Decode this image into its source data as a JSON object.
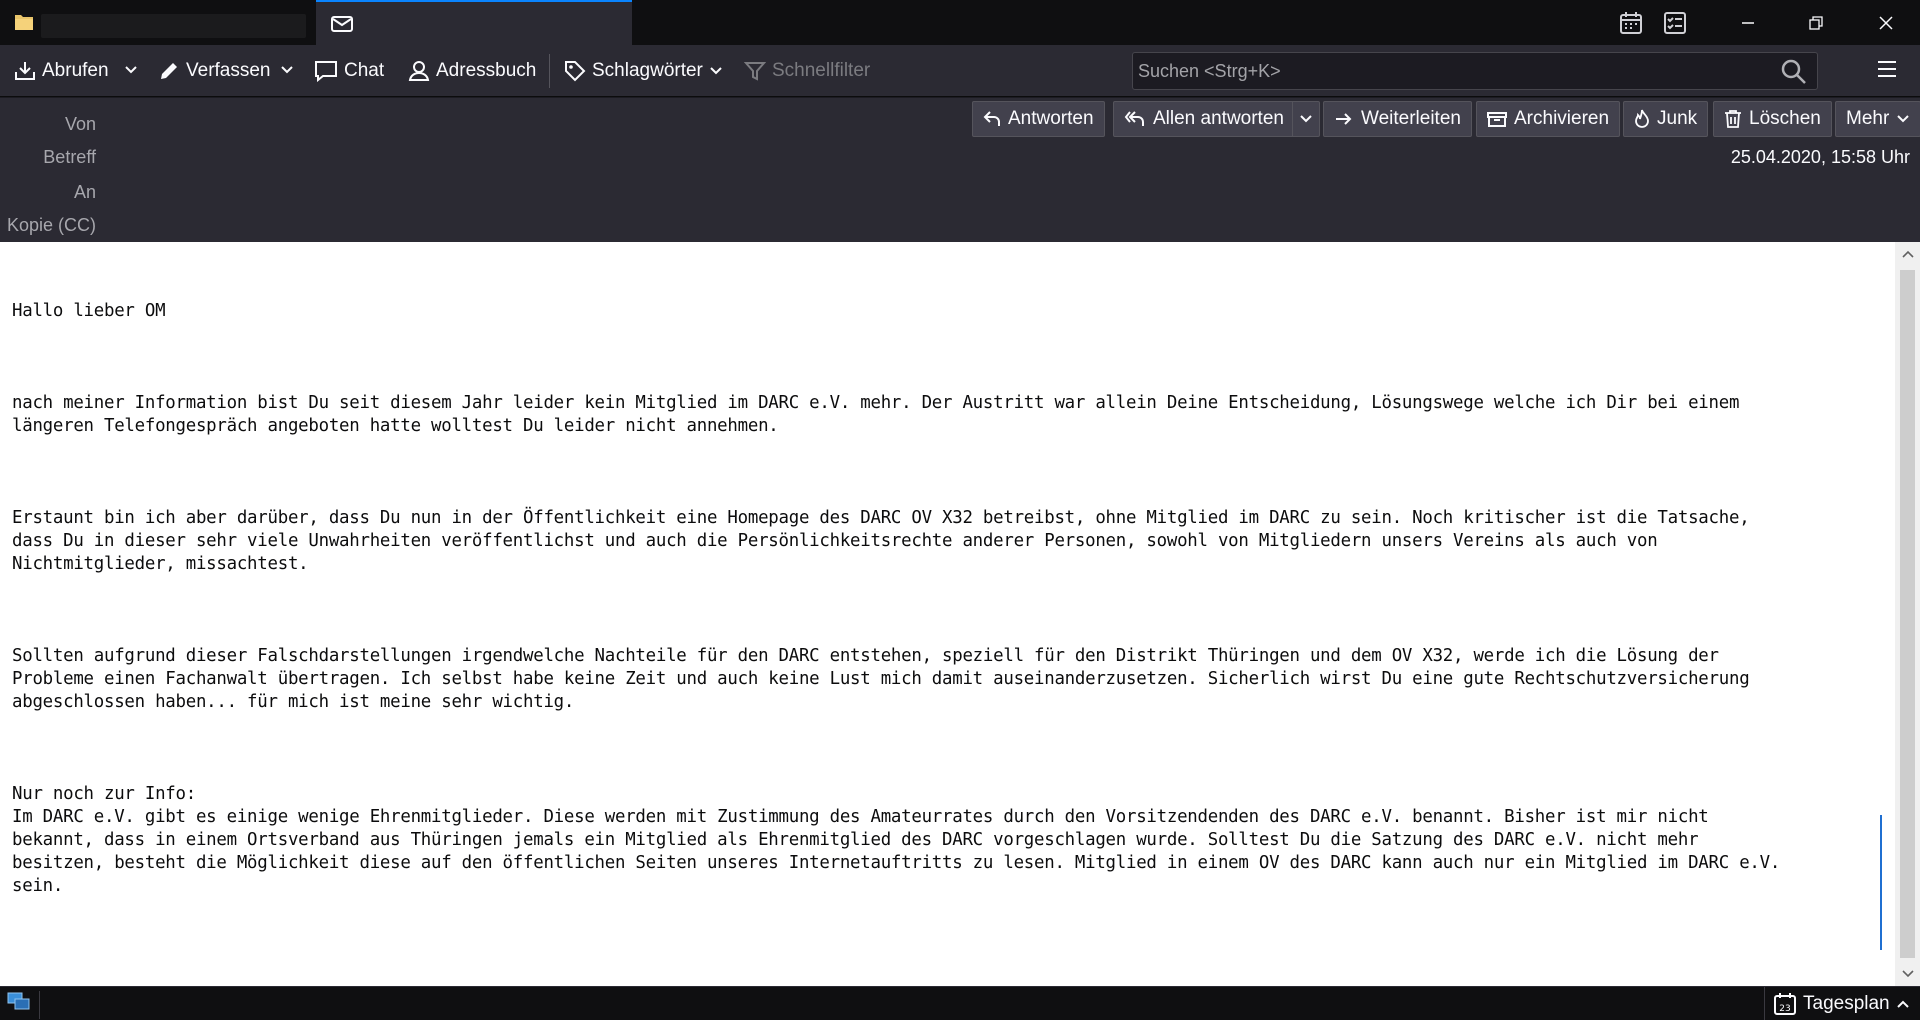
{
  "tabs": [
    {
      "label": "",
      "icon": "folder-icon",
      "active": false
    },
    {
      "label": "",
      "icon": "mail-icon",
      "active": true
    }
  ],
  "titlebar": {
    "icons": [
      "calendar-icon",
      "tasks-icon"
    ]
  },
  "toolbar": {
    "get_messages": "Abrufen",
    "compose": "Verfassen",
    "chat": "Chat",
    "address_book": "Adressbuch",
    "tags": "Schlagwörter",
    "quick_filter": "Schnellfilter",
    "search_placeholder": "Suchen <Strg+K>"
  },
  "header": {
    "labels": {
      "from": "Von",
      "subject": "Betreff",
      "to": "An",
      "cc": "Kopie (CC)"
    },
    "date": "25.04.2020, 15:58 Uhr",
    "actions": {
      "reply": "Antworten",
      "reply_all": "Allen antworten",
      "forward": "Weiterleiten",
      "archive": "Archivieren",
      "junk": "Junk",
      "delete": "Löschen",
      "more": "Mehr"
    }
  },
  "message": {
    "paragraphs": [
      "Hallo lieber OM",
      "nach meiner Information bist Du seit diesem Jahr leider kein Mitglied im DARC e.V. mehr. Der Austritt war allein Deine Entscheidung, Lösungswege welche ich Dir bei einem\nlängeren Telefongespräch angeboten hatte wolltest Du leider nicht annehmen.",
      "Erstaunt bin ich aber darüber, dass Du nun in der Öffentlichkeit eine Homepage des DARC OV X32 betreibst, ohne Mitglied im DARC zu sein. Noch kritischer ist die Tatsache,\ndass Du in dieser sehr viele Unwahrheiten veröffentlichst und auch die Persönlichkeitsrechte anderer Personen, sowohl von Mitgliedern unsers Vereins als auch von\nNichtmitglieder, missachtest.",
      "Sollten aufgrund dieser Falschdarstellungen irgendwelche Nachteile für den DARC entstehen, speziell für den Distrikt Thüringen und dem OV X32, werde ich die Lösung der\nProbleme einen Fachanwalt übertragen. Ich selbst habe keine Zeit und auch keine Lust mich damit auseinanderzusetzen. Sicherlich wirst Du eine gute Rechtschutzversicherung\nabgeschlossen haben... für mich ist meine sehr wichtig.",
      "Nur noch zur Info:\nIm DARC e.V. gibt es einige wenige Ehrenmitglieder. Diese werden mit Zustimmung des Amateurrates durch den Vorsitzendenden des DARC e.V. benannt. Bisher ist mir nicht\nbekannt, dass in einem Ortsverband aus Thüringen jemals ein Mitglied als Ehrenmitglied des DARC vorgeschlagen wurde. Solltest Du die Satzung des DARC e.V. nicht mehr\nbesitzen, besteht die Möglichkeit diese auf den öffentlichen Seiten unseres Internetauftritts zu lesen. Mitglied in einem OV des DARC kann auch nur ein Mitglied im DARC e.V.\nsein."
    ]
  },
  "statusbar": {
    "today_pane": "Tagesplan",
    "today_pane_day": "23"
  },
  "colors": {
    "accent": "#0a84ff",
    "toolbar_bg": "#2b2a33",
    "tabbar_bg": "#0f0f11",
    "body_bg": "#ffffff"
  }
}
